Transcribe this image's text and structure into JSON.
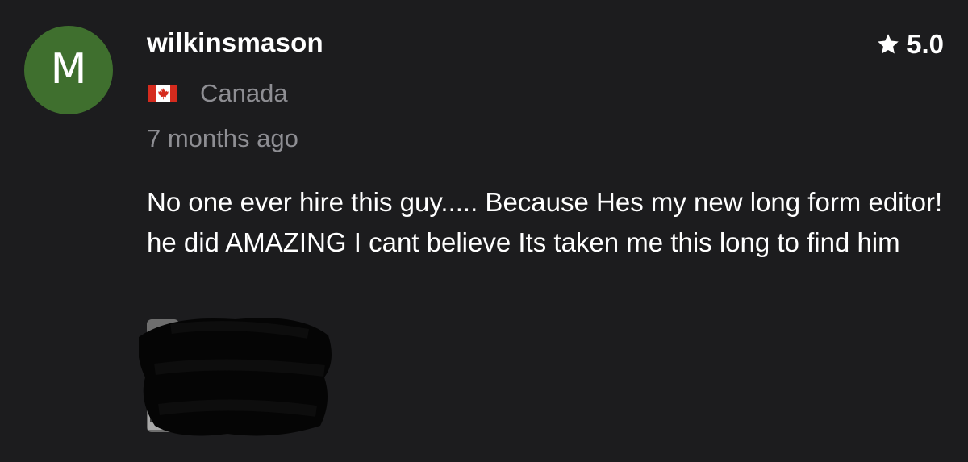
{
  "review": {
    "avatar_letter": "M",
    "avatar_color": "#3f6f2e",
    "username": "wilkinsmason",
    "rating": "5.0",
    "rating_icon": "star-icon",
    "country": {
      "flag_icon": "canada-flag-icon",
      "name": "Canada"
    },
    "timestamp": "7 months ago",
    "text": "No one ever hire this guy..... Because Hes my new long form editor! he did AMAZING I cant believe Its taken me this long to find him",
    "attachment_icon": "redacted-image-thumbnail"
  }
}
